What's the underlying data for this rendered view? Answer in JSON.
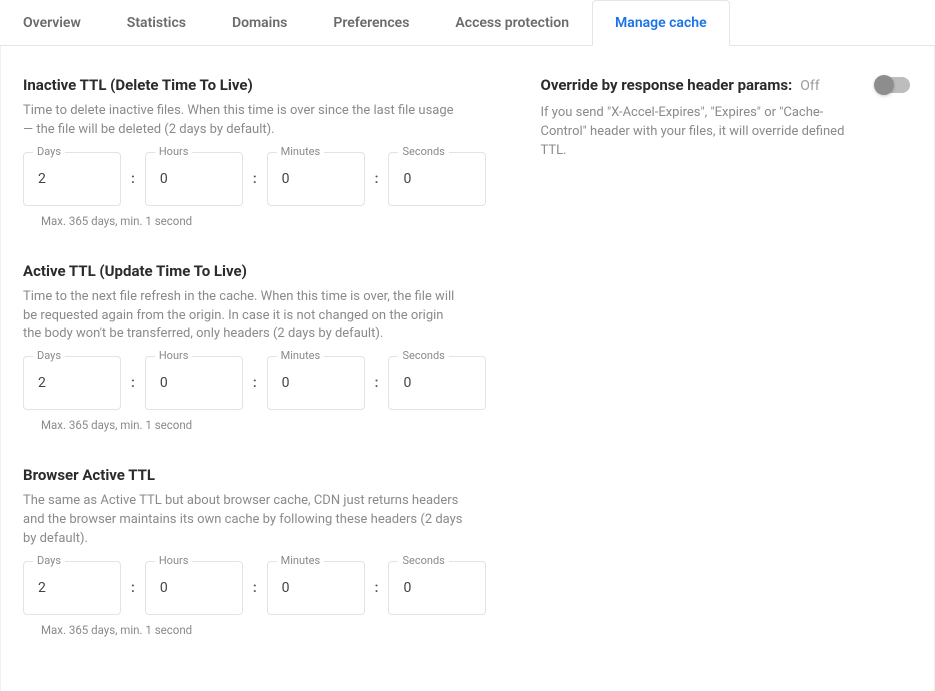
{
  "tabs": {
    "overview": "Overview",
    "statistics": "Statistics",
    "domains": "Domains",
    "preferences": "Preferences",
    "access_protection": "Access protection",
    "manage_cache": "Manage cache"
  },
  "labels": {
    "days": "Days",
    "hours": "Hours",
    "minutes": "Minutes",
    "seconds": "Seconds",
    "colon": ":"
  },
  "hints": {
    "range": "Max. 365 days, min. 1 second"
  },
  "sections": {
    "inactive_ttl": {
      "title": "Inactive TTL (Delete Time To Live)",
      "desc": "Time to delete inactive files. When this time is over since the last file usage — the file will be deleted (2 days by default).",
      "days": "2",
      "hours": "0",
      "minutes": "0",
      "seconds": "0"
    },
    "active_ttl": {
      "title": "Active TTL (Update Time To Live)",
      "desc": "Time to the next file refresh in the cache. When this time is over, the file will be requested again from the origin. In case it is not changed on the origin the body won't be transferred, only headers (2 days by default).",
      "days": "2",
      "hours": "0",
      "minutes": "0",
      "seconds": "0"
    },
    "browser_active_ttl": {
      "title": "Browser Active TTL",
      "desc": "The same as Active TTL but about browser cache, CDN just returns headers and the browser maintains its own cache by following these headers (2 days by default).",
      "days": "2",
      "hours": "0",
      "minutes": "0",
      "seconds": "0"
    }
  },
  "override": {
    "title": "Override by response header params:",
    "state": "Off",
    "desc": "If you send \"X-Accel-Expires\", \"Expires\" or \"Cache-Control\" header with your files, it will override defined TTL."
  }
}
